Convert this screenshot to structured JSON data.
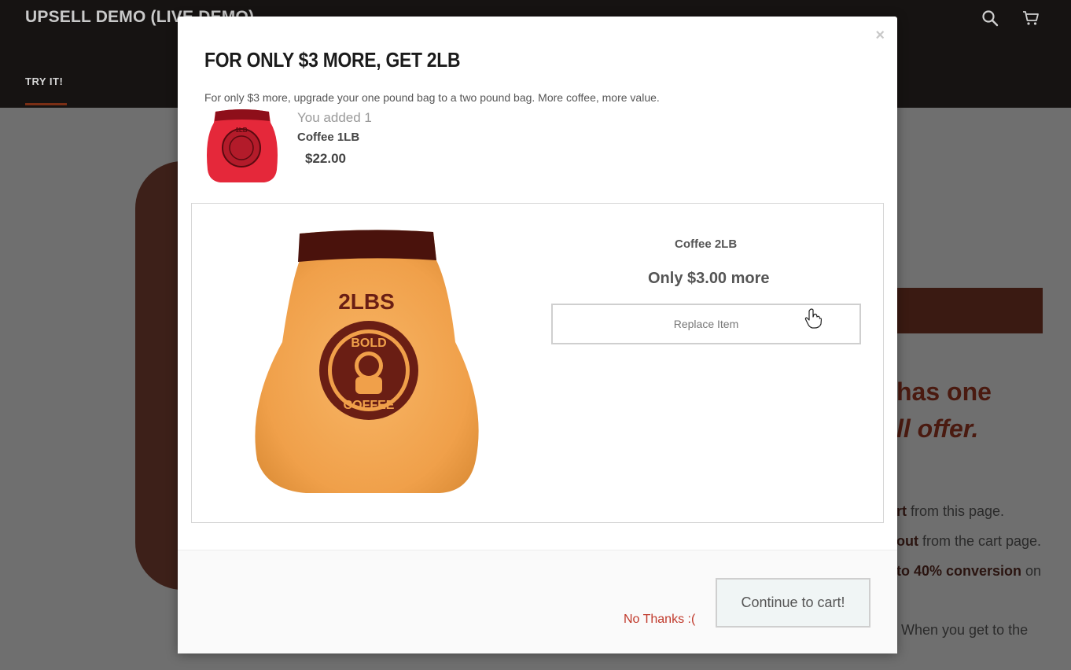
{
  "store": {
    "title": "UPSELL DEMO (LIVE DEMO)",
    "nav_item": "TRY IT!",
    "bg_heading_1": "has one",
    "bg_heading_2": "ll offer.",
    "bg_line_1_bold": "rt",
    "bg_line_1": " from this page.",
    "bg_line_2_bold": "out",
    "bg_line_2": " from the cart page.",
    "bg_line_3_bold": "to 40% conversion",
    "bg_line_3": " on",
    "bg_line_4": "When you get to the"
  },
  "modal": {
    "close_label": "×",
    "title": "FOR ONLY $3 MORE, GET 2LB",
    "subtitle": "For only $3 more, upgrade your one pound bag to a two pound bag. More coffee, more value.",
    "added": {
      "label": "You added 1",
      "name": "Coffee 1LB",
      "price": "$22.00"
    },
    "offer": {
      "name": "Coffee 2LB",
      "price": "Only $3.00 more",
      "button": "Replace Item",
      "bag_text": "2LBS",
      "seal_top": "BOLD",
      "seal_bottom": "COFFEE"
    },
    "footer": {
      "decline": "No Thanks :(",
      "continue": "Continue to cart!"
    }
  },
  "colors": {
    "accent_red": "#c0392b",
    "bag_orange": "#f2a04d",
    "bag_brown": "#5a1a12",
    "small_bag_red": "#e5283a"
  }
}
